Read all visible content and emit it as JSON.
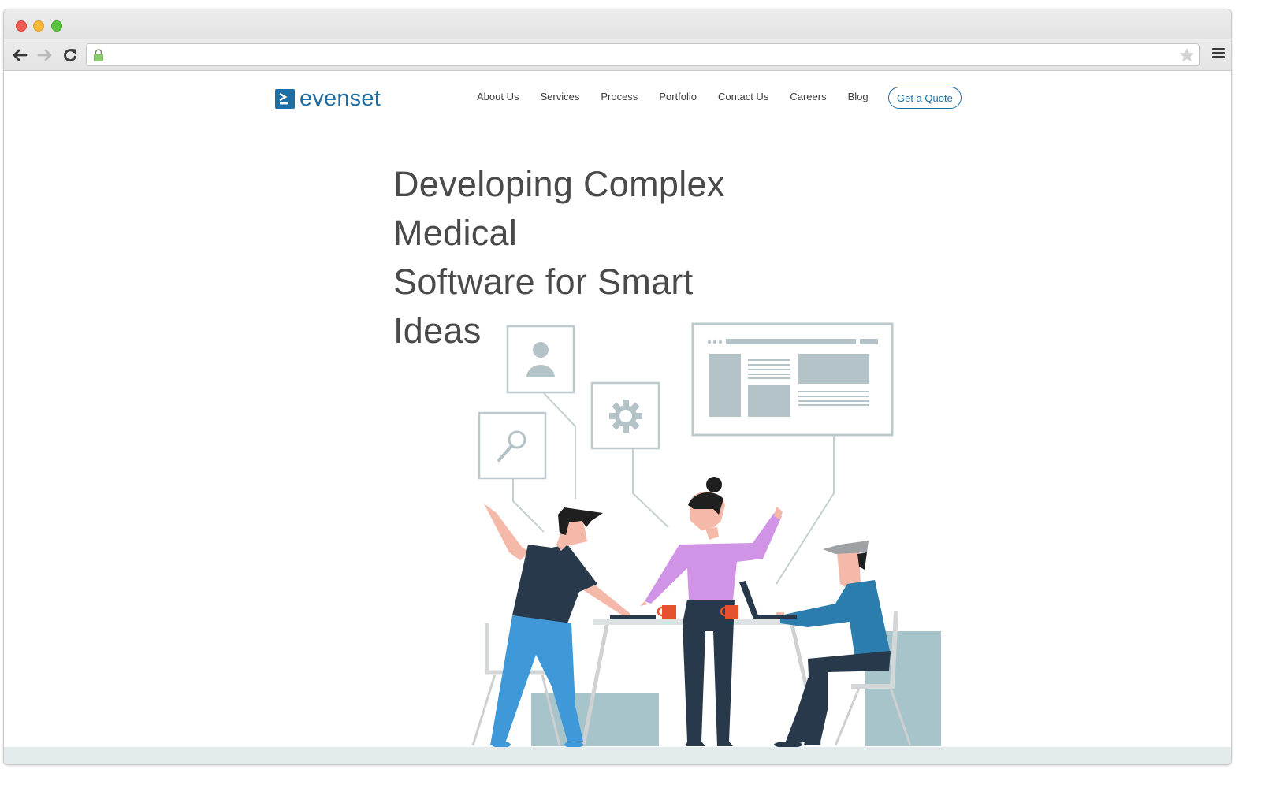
{
  "browser": {
    "traffic_lights": [
      "close",
      "minimize",
      "maximize"
    ],
    "toolbar": {
      "back_icon": "arrow-left-icon",
      "forward_icon": "arrow-right-icon",
      "reload_icon": "reload-icon",
      "url": "",
      "secure": true,
      "bookmark_icon": "star-icon",
      "menu_icon": "hamburger-menu-icon"
    }
  },
  "site": {
    "brand": "evenset",
    "brand_color": "#1c6ea4",
    "nav": [
      {
        "label": "About Us"
      },
      {
        "label": "Services"
      },
      {
        "label": "Process"
      },
      {
        "label": "Portfolio"
      },
      {
        "label": "Contact Us"
      },
      {
        "label": "Careers"
      },
      {
        "label": "Blog"
      }
    ],
    "cta_label": "Get a Quote"
  },
  "hero": {
    "title_lines": [
      "Developing Complex",
      "Medical",
      "Software for Smart",
      "Ideas"
    ],
    "illustration": {
      "description": "Three people collaborating at a table with laptops and coffee mugs; floating UI cards above",
      "cards": [
        "user-profile-icon",
        "search-icon",
        "gear-icon",
        "web-page-wireframe"
      ],
      "colors": {
        "outline": "#b7c7cc",
        "fill": "#b2c2c8",
        "skin": "#f4b9a8",
        "dark": "#27394a",
        "jeans": "#3f99d8",
        "purple_top": "#d193e6",
        "blue_sweater": "#2a7dac",
        "cap": "#9fa2a4",
        "mug": "#e6512f",
        "box": "#a8c4cb",
        "table": "#dde3e4",
        "chair": "#d0d4d5"
      }
    }
  }
}
